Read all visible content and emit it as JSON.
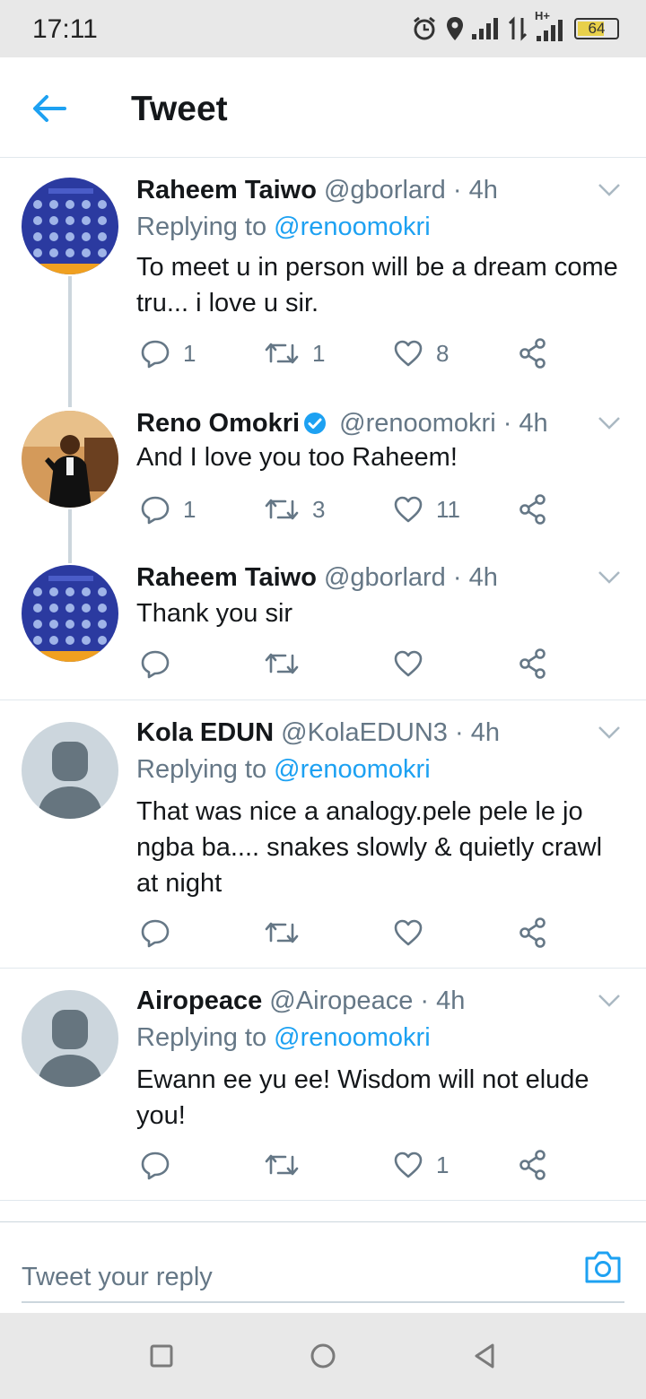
{
  "status_bar": {
    "time": "17:11",
    "battery_level": "64",
    "network_label": "H+"
  },
  "header": {
    "title": "Tweet",
    "back_icon": "arrow-left-icon"
  },
  "tweets": [
    {
      "name": "Raheem Taiwo",
      "handle": "@gborlard",
      "time": "· 4h",
      "replying_prefix": "Replying to",
      "replying_to": "@renoomokri",
      "text": "To meet u in person will be a dream come tru... i love u sir.",
      "replies": "1",
      "retweets": "1",
      "likes": "8",
      "verified": false
    },
    {
      "name": "Reno Omokri",
      "handle": "@renoomokri",
      "time": "· 4h",
      "text": "And I love you too Raheem!",
      "replies": "1",
      "retweets": "3",
      "likes": "11",
      "verified": true
    },
    {
      "name": "Raheem Taiwo",
      "handle": "@gborlard",
      "time": "· 4h",
      "text": "Thank you sir",
      "replies": "",
      "retweets": "",
      "likes": "",
      "verified": false
    },
    {
      "name": "Kola EDUN",
      "handle": "@KolaEDUN3",
      "time": "· 4h",
      "replying_prefix": "Replying to",
      "replying_to": "@renoomokri",
      "text": "That was nice a analogy.pele pele le jo ngba ba.... snakes slowly & quietly crawl at night",
      "replies": "",
      "retweets": "",
      "likes": "",
      "verified": false
    },
    {
      "name": "Airopeace",
      "handle": "@Airopeace",
      "time": "· 4h",
      "replying_prefix": "Replying to",
      "replying_to": "@renoomokri",
      "text": "Ewann ee yu ee!  Wisdom will not elude you!",
      "replies": "",
      "retweets": "",
      "likes": "1",
      "verified": false
    }
  ],
  "composer": {
    "placeholder": "Tweet your reply"
  },
  "colors": {
    "accent": "#1da1f2",
    "secondary_text": "#657786",
    "divider": "#e1e8ed"
  }
}
